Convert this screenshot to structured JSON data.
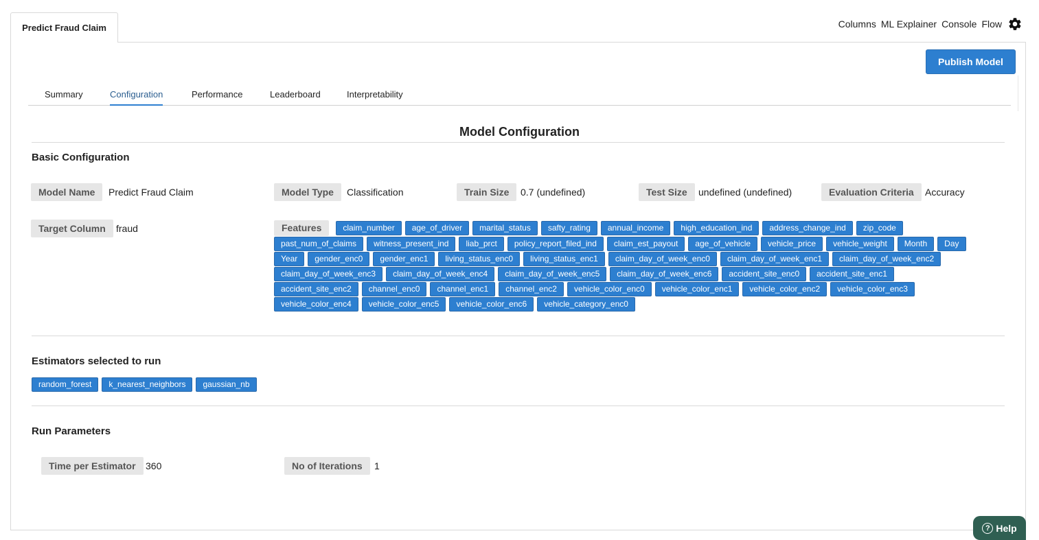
{
  "app": {
    "tab_label": "Predict Fraud Claim",
    "top_links": [
      "Columns",
      "ML Explainer",
      "Console",
      "Flow"
    ],
    "settings_icon": "gear-icon",
    "publish_label": "Publish Model"
  },
  "subtabs": [
    "Summary",
    "Configuration",
    "Performance",
    "Leaderboard",
    "Interpretability"
  ],
  "active_subtab": "Configuration",
  "config": {
    "title": "Model Configuration",
    "basic_title": "Basic Configuration",
    "model_name_label": "Model Name",
    "model_name": "Predict Fraud Claim",
    "model_type_label": "Model Type",
    "model_type": "Classification",
    "train_size_label": "Train Size",
    "train_size": "0.7 (undefined)",
    "test_size_label": "Test Size",
    "test_size": "undefined (undefined)",
    "eval_label": "Evaluation Criteria",
    "eval": "Accuracy",
    "target_label": "Target Column",
    "target": "fraud",
    "features_label": "Features",
    "features": [
      "claim_number",
      "age_of_driver",
      "marital_status",
      "safty_rating",
      "annual_income",
      "high_education_ind",
      "address_change_ind",
      "zip_code",
      "past_num_of_claims",
      "witness_present_ind",
      "liab_prct",
      "policy_report_filed_ind",
      "claim_est_payout",
      "age_of_vehicle",
      "vehicle_price",
      "vehicle_weight",
      "Month",
      "Day",
      "Year",
      "gender_enc0",
      "gender_enc1",
      "living_status_enc0",
      "living_status_enc1",
      "claim_day_of_week_enc0",
      "claim_day_of_week_enc1",
      "claim_day_of_week_enc2",
      "claim_day_of_week_enc3",
      "claim_day_of_week_enc4",
      "claim_day_of_week_enc5",
      "claim_day_of_week_enc6",
      "accident_site_enc0",
      "accident_site_enc1",
      "accident_site_enc2",
      "channel_enc0",
      "channel_enc1",
      "channel_enc2",
      "vehicle_color_enc0",
      "vehicle_color_enc1",
      "vehicle_color_enc2",
      "vehicle_color_enc3",
      "vehicle_color_enc4",
      "vehicle_color_enc5",
      "vehicle_color_enc6",
      "vehicle_category_enc0"
    ]
  },
  "estimators": {
    "title": "Estimators selected to run",
    "items": [
      "random_forest",
      "k_nearest_neighbors",
      "gaussian_nb"
    ]
  },
  "run_params": {
    "title": "Run Parameters",
    "time_label": "Time per Estimator",
    "time": "360",
    "iter_label": "No of Iterations",
    "iter": "1"
  },
  "help": {
    "label": "Help"
  },
  "colors": {
    "accent": "#2d7fd0",
    "label_bg": "#e6e6e6",
    "help_bg": "#2f5f52"
  }
}
